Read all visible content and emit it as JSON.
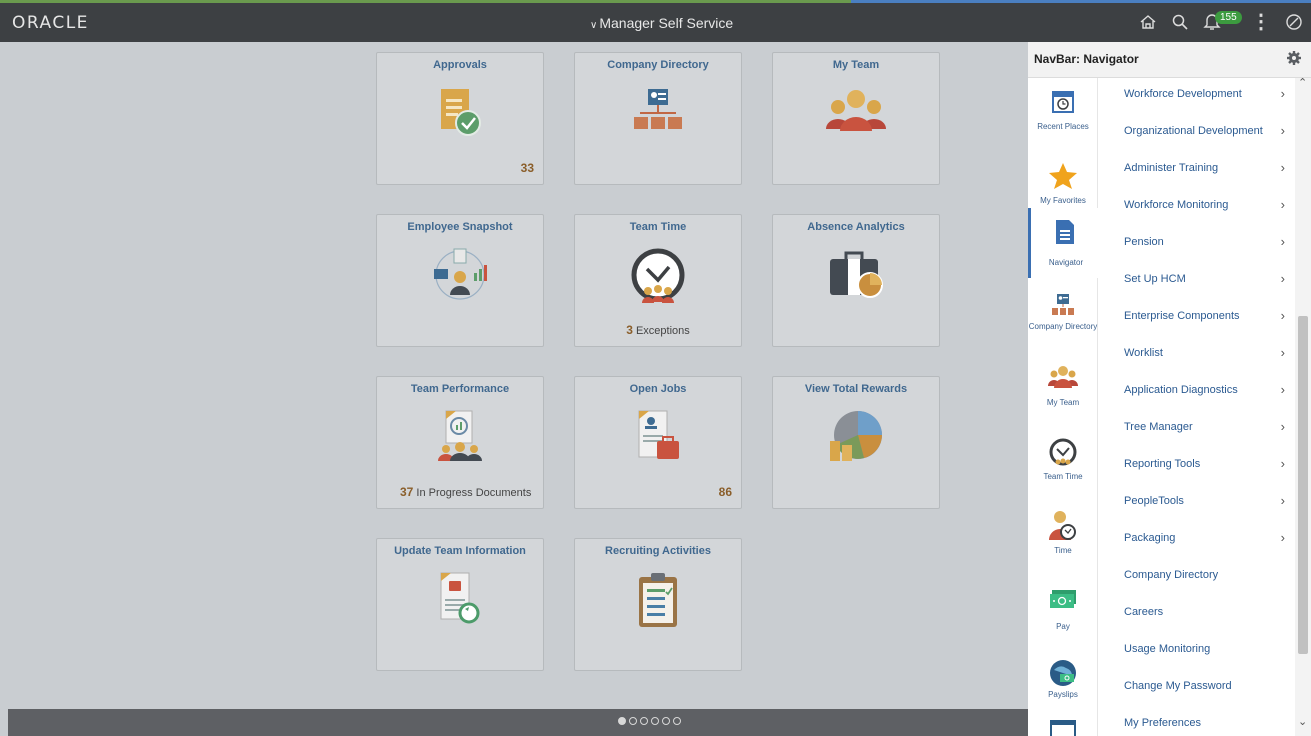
{
  "header": {
    "logo": "ORACLE",
    "title": "Manager Self Service",
    "notification_count": "155"
  },
  "tiles": [
    {
      "title": "Approvals",
      "count": "33"
    },
    {
      "title": "Company Directory"
    },
    {
      "title": "My Team"
    },
    {
      "title": "Employee Snapshot"
    },
    {
      "title": "Team Time",
      "caption_num": "3",
      "caption_text": " Exceptions"
    },
    {
      "title": "Absence Analytics"
    },
    {
      "title": "Team Performance",
      "caption_num": "37",
      "caption_text": " In Progress Documents"
    },
    {
      "title": "Open Jobs",
      "count": "86"
    },
    {
      "title": "View Total Rewards"
    },
    {
      "title": "Update Team Information"
    },
    {
      "title": "Recruiting Activities"
    }
  ],
  "pager": {
    "pages": 6,
    "active": 1
  },
  "navbar": {
    "title": "NavBar: Navigator",
    "left_buttons": [
      {
        "label": "Recent Places",
        "icon": "recent-places-icon"
      },
      {
        "label": "My Favorites",
        "icon": "star-icon"
      },
      {
        "label": "Navigator",
        "icon": "navigator-icon"
      },
      {
        "label": "Company Directory",
        "icon": "company-directory-icon"
      },
      {
        "label": "My Team",
        "icon": "my-team-icon"
      },
      {
        "label": "Team Time",
        "icon": "team-time-icon"
      },
      {
        "label": "Time",
        "icon": "time-icon"
      },
      {
        "label": "Pay",
        "icon": "pay-icon"
      },
      {
        "label": "Payslips",
        "icon": "payslips-icon"
      }
    ],
    "menu_items": [
      {
        "label": "Workforce Development",
        "arrow": "›"
      },
      {
        "label": "Organizational Development",
        "arrow": "›"
      },
      {
        "label": "Administer Training",
        "arrow": "›"
      },
      {
        "label": "Workforce Monitoring",
        "arrow": "›"
      },
      {
        "label": "Pension",
        "arrow": "›"
      },
      {
        "label": "Set Up HCM",
        "arrow": "›"
      },
      {
        "label": "Enterprise Components",
        "arrow": "›"
      },
      {
        "label": "Worklist",
        "arrow": "›"
      },
      {
        "label": "Application Diagnostics",
        "arrow": "›"
      },
      {
        "label": "Tree Manager",
        "arrow": "›"
      },
      {
        "label": "Reporting Tools",
        "arrow": "›"
      },
      {
        "label": "PeopleTools",
        "arrow": "›"
      },
      {
        "label": "Packaging",
        "arrow": "›"
      },
      {
        "label": "Company Directory",
        "arrow": ""
      },
      {
        "label": "Careers",
        "arrow": ""
      },
      {
        "label": "Usage Monitoring",
        "arrow": ""
      },
      {
        "label": "Change My Password",
        "arrow": ""
      },
      {
        "label": "My Preferences",
        "arrow": ""
      }
    ]
  },
  "colors": {
    "header_bg": "#3d4043",
    "tile_title": "#40688f",
    "count": "#8a5e2a",
    "nav_link": "#2b5a91",
    "badge": "#3c9b3f"
  }
}
